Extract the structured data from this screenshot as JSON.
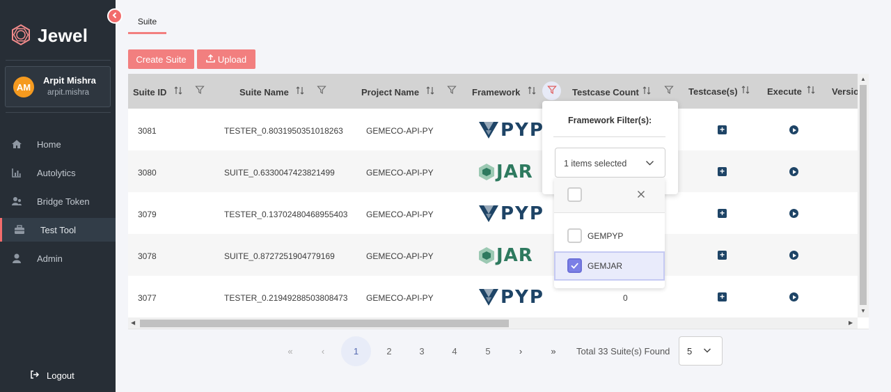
{
  "app": {
    "name": "Jewel",
    "accent": "#f27f7f",
    "sidebar_bg": "#272e36"
  },
  "user": {
    "initials": "AM",
    "name": "Arpit Mishra",
    "handle": "arpit.mishra"
  },
  "nav": [
    {
      "label": "Home",
      "icon": "home-icon"
    },
    {
      "label": "Autolytics",
      "icon": "bar-chart-icon"
    },
    {
      "label": "Bridge Token",
      "icon": "users-icon"
    },
    {
      "label": "Test Tool",
      "icon": "toolbox-icon",
      "active": true
    },
    {
      "label": "Admin",
      "icon": "user-icon"
    }
  ],
  "logout_label": "Logout",
  "tab_label": "Suite",
  "buttons": {
    "create": "Create Suite",
    "upload": "Upload"
  },
  "columns": [
    "Suite ID",
    "Suite Name",
    "Project Name",
    "Framework",
    "Testcase Count",
    "Testcase(s)",
    "Execute",
    "Versio"
  ],
  "rows": [
    {
      "id": "3081",
      "name": "TESTER_0.8031950351018263",
      "project": "GEMECO-API-PY",
      "framework": "PYP",
      "count": ""
    },
    {
      "id": "3080",
      "name": "SUITE_0.6330047423821499",
      "project": "GEMECO-API-PY",
      "framework": "JAR",
      "count": ""
    },
    {
      "id": "3079",
      "name": "TESTER_0.13702480468955403",
      "project": "GEMECO-API-PY",
      "framework": "PYP",
      "count": ""
    },
    {
      "id": "3078",
      "name": "SUITE_0.8727251904779169",
      "project": "GEMECO-API-PY",
      "framework": "JAR",
      "count": ""
    },
    {
      "id": "3077",
      "name": "TESTER_0.21949288503808473",
      "project": "GEMECO-API-PY",
      "framework": "PYP",
      "count": "0"
    }
  ],
  "pagination": {
    "pages": [
      "1",
      "2",
      "3",
      "4",
      "5"
    ],
    "current": "1",
    "total_text": "Total 33 Suite(s) Found",
    "per_page": "5"
  },
  "filter_popup": {
    "title": "Framework Filter(s):",
    "selected_text": "1 items selected",
    "options": [
      {
        "label": "GEMPYP",
        "checked": false
      },
      {
        "label": "GEMJAR",
        "checked": true
      }
    ]
  }
}
